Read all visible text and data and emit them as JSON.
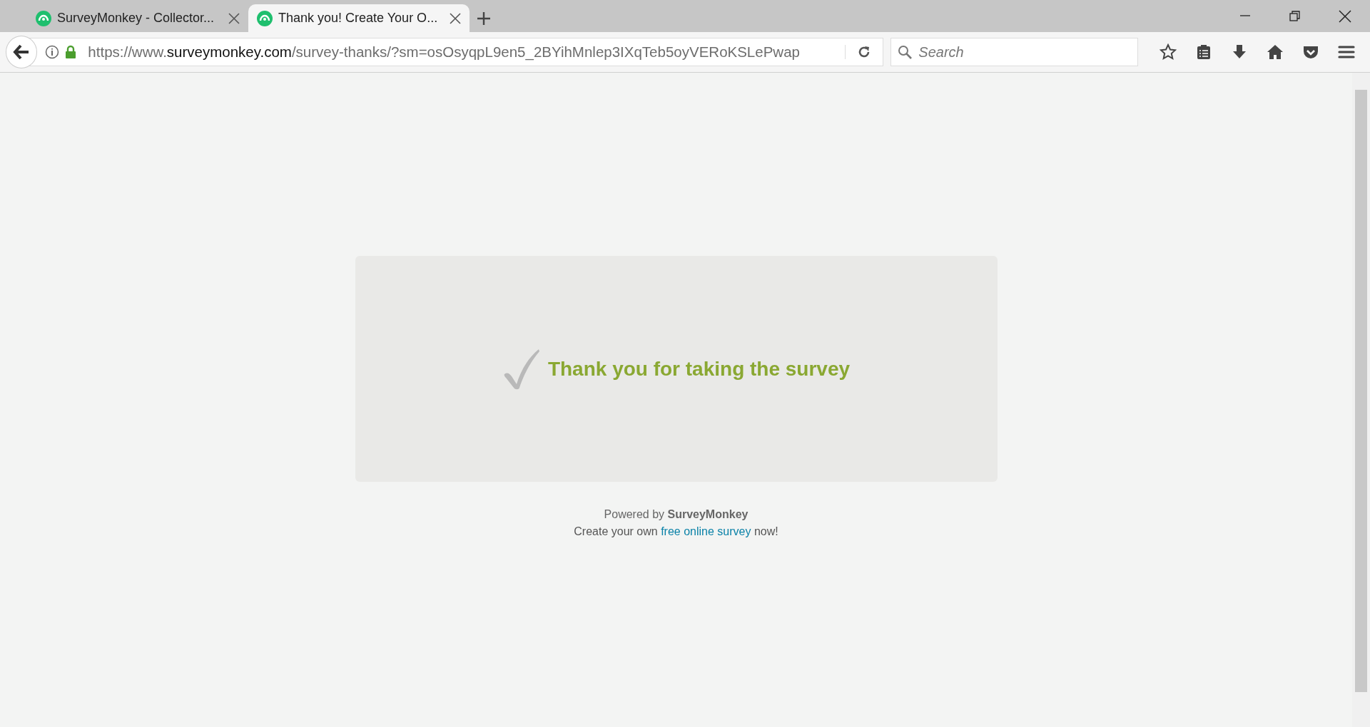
{
  "browser": {
    "tabs": [
      {
        "title": "SurveyMonkey - Collector...",
        "selected": false
      },
      {
        "title": "Thank you! Create Your O...",
        "selected": true
      }
    ],
    "address": {
      "scheme": "https://www.",
      "host": "surveymonkey.com",
      "path": "/survey-thanks/?sm=osOsyqpL9en5_2BYihMnlep3IXqTeb5oyVERoKSLePwap"
    },
    "search": {
      "placeholder": "Search"
    }
  },
  "page": {
    "message": "Thank you for taking the survey",
    "powered_by": "Powered by **SurveyMonkey**",
    "create_line": {
      "before": "Create your own",
      "link": "free online survey",
      "after": "now!"
    }
  }
}
